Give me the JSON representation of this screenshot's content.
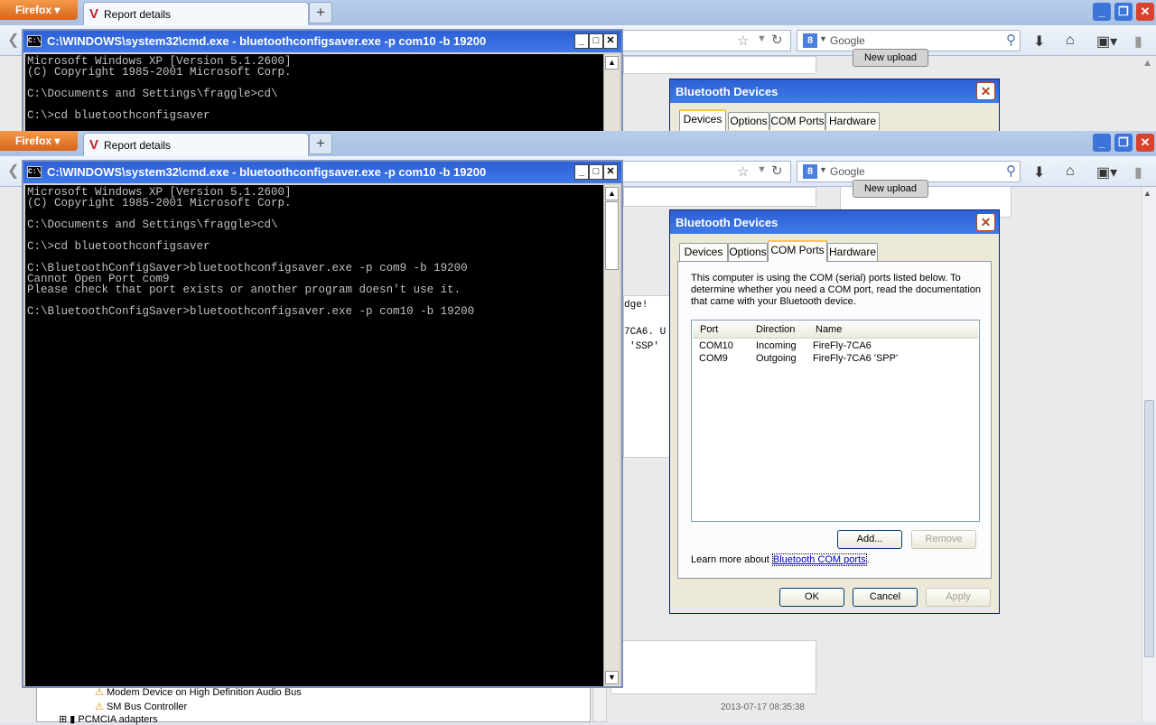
{
  "firefox": {
    "button_label": "Firefox",
    "tab_title": "Report details",
    "new_tab": "+",
    "search_placeholder": "Google",
    "search_engine": "g-icon"
  },
  "page": {
    "new_upload_button": "New upload",
    "snippet_lines": [
      "dge!",
      "7CA6. U",
      "'SSP'"
    ],
    "device_tree": [
      "Modem Device on High Definition Audio Bus",
      "SM Bus Controller",
      "PCMCIA adapters"
    ],
    "timestamp": "2013-07-17 08:35:38"
  },
  "cmd": {
    "title": "C:\\WINDOWS\\system32\\cmd.exe - bluetoothconfigsaver.exe -p com10 -b 19200",
    "icon_text": "C:\\",
    "back_lines": [
      "Microsoft Windows XP [Version 5.1.2600]",
      "(C) Copyright 1985-2001 Microsoft Corp.",
      "",
      "C:\\Documents and Settings\\fraggle>cd\\",
      "",
      "C:\\>cd bluetoothconfigsaver"
    ],
    "lines": [
      "Microsoft Windows XP [Version 5.1.2600]",
      "(C) Copyright 1985-2001 Microsoft Corp.",
      "",
      "C:\\Documents and Settings\\fraggle>cd\\",
      "",
      "C:\\>cd bluetoothconfigsaver",
      "",
      "C:\\BluetoothConfigSaver>bluetoothconfigsaver.exe -p com9 -b 19200",
      "Cannot Open Port com9",
      "Please check that port exists or another program doesn't use it.",
      "",
      "C:\\BluetoothConfigSaver>bluetoothconfigsaver.exe -p com10 -b 19200"
    ]
  },
  "bluetooth": {
    "title": "Bluetooth Devices",
    "tabs": [
      "Devices",
      "Options",
      "COM Ports",
      "Hardware"
    ],
    "active_tab": "COM Ports",
    "description": "This computer is using the COM (serial) ports listed below. To determine whether you need a COM port, read the documentation that came with your Bluetooth device.",
    "columns": [
      "Port",
      "Direction",
      "Name"
    ],
    "rows": [
      {
        "port": "COM10",
        "direction": "Incoming",
        "name": "FireFly-7CA6"
      },
      {
        "port": "COM9",
        "direction": "Outgoing",
        "name": "FireFly-7CA6 'SPP'"
      }
    ],
    "add_button": "Add...",
    "remove_button": "Remove",
    "learn_prefix": "Learn more about ",
    "learn_link": "Bluetooth COM ports",
    "learn_suffix": ".",
    "ok_button": "OK",
    "cancel_button": "Cancel",
    "apply_button": "Apply"
  }
}
